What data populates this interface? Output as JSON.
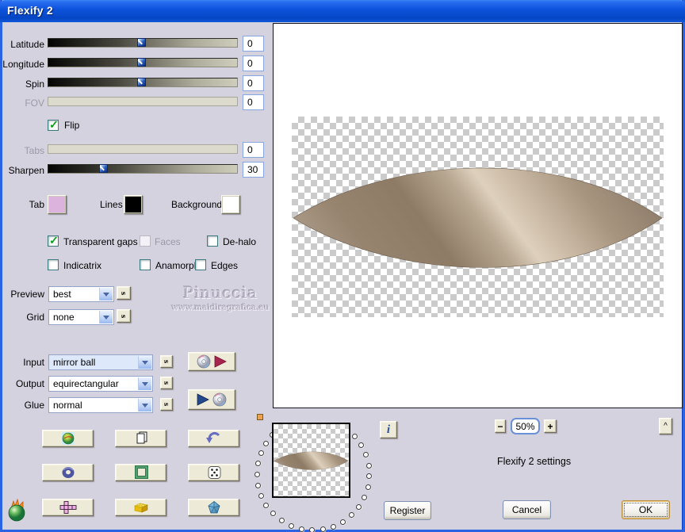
{
  "window": {
    "title": "Flexify 2"
  },
  "sliders": {
    "latitude": {
      "label": "Latitude",
      "value": "0",
      "disabled": false
    },
    "longitude": {
      "label": "Longitude",
      "value": "0",
      "disabled": false
    },
    "spin": {
      "label": "Spin",
      "value": "0",
      "disabled": false
    },
    "fov": {
      "label": "FOV",
      "value": "0",
      "disabled": true
    },
    "tabs": {
      "label": "Tabs",
      "value": "0",
      "disabled": true
    },
    "sharpen": {
      "label": "Sharpen",
      "value": "30",
      "disabled": false
    }
  },
  "flip": {
    "label": "Flip",
    "checked": true
  },
  "swatches": {
    "tab": {
      "label": "Tab",
      "color": "#dcb3dd"
    },
    "lines": {
      "label": "Lines",
      "color": "#000000"
    },
    "background": {
      "label": "Background",
      "color": "#ffffff"
    }
  },
  "checkboxes": {
    "transparent_gaps": {
      "label": "Transparent gaps",
      "checked": true,
      "disabled": false
    },
    "faces": {
      "label": "Faces",
      "checked": false,
      "disabled": true
    },
    "de_halo": {
      "label": "De-halo",
      "checked": false,
      "disabled": false
    },
    "indicatrix": {
      "label": "Indicatrix",
      "checked": false,
      "disabled": false
    },
    "anamorph": {
      "label": "Anamorph",
      "checked": false,
      "disabled": false
    },
    "edges": {
      "label": "Edges",
      "checked": false,
      "disabled": false
    }
  },
  "combos": {
    "preview": {
      "label": "Preview",
      "value": "best"
    },
    "grid": {
      "label": "Grid",
      "value": "none"
    },
    "input": {
      "label": "Input",
      "value": "mirror ball"
    },
    "output": {
      "label": "Output",
      "value": "equirectangular"
    },
    "glue": {
      "label": "Glue",
      "value": "normal"
    }
  },
  "watermark": {
    "name": "Pinuccia",
    "url": "www.maidiregrafica.eu"
  },
  "zoom": {
    "minus": "−",
    "value": "50%",
    "plus": "+",
    "collapse": "^"
  },
  "status_text": "Flexify 2 settings",
  "buttons": {
    "info": "i",
    "register": "Register",
    "cancel": "Cancel",
    "ok": "OK",
    "s_glyph": "s"
  },
  "icons": {
    "check_glyph": "✓",
    "combo_arrow": "chevron-down",
    "s_button": "cycle-s",
    "cd_red_play": "load-settings-disc",
    "cd_blue_play": "save-settings-disc",
    "grid_buttons": [
      "globe-orb",
      "copy-pages",
      "undo-arrow",
      "torus",
      "green-frame",
      "dice",
      "cube-net",
      "lego-brick",
      "polyhedron"
    ],
    "logo": "flaming-pear-logo"
  },
  "colors": {
    "dialog_bg": "#d5d2df",
    "title_blue": "#0c52dc",
    "check_green": "#0aa018",
    "lens_light": "#ddd0bd",
    "lens_dark": "#8d7b66"
  }
}
